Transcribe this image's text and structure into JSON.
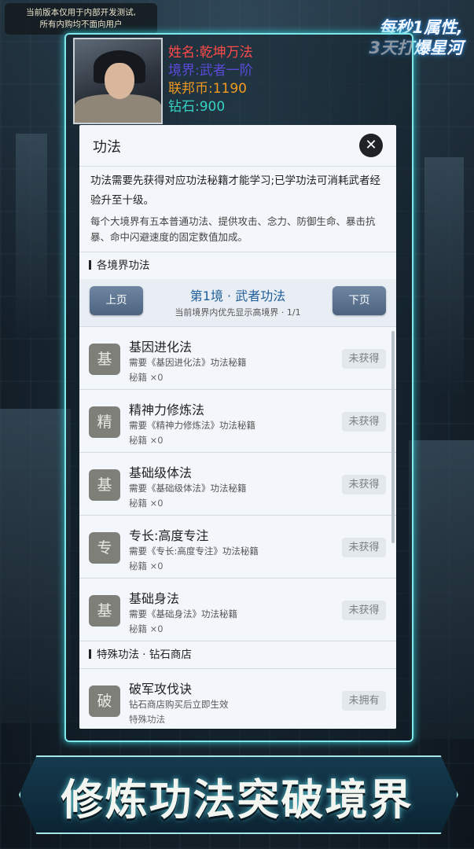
{
  "notice": {
    "line1": "当前版本仅用于内部开发测试,",
    "line2": "所有内购均不面向用户"
  },
  "slogan": {
    "line1": "每秒1属性,",
    "line2": "3天打爆星河"
  },
  "profile": {
    "name": "姓名:乾坤万法",
    "realm": "境界:武者一阶",
    "coin": "联邦币:1190",
    "diamond": "钻石:900"
  },
  "panel": {
    "title": "功法",
    "close_icon": "close-icon",
    "intro_main": "功法需要先获得对应功法秘籍才能学习;已学功法可消耗武者经验升至十级。",
    "intro_sub": "每个大境界有五本普通功法、提供攻击、念力、防御生命、暴击抗暴、命中闪避速度的固定数值加成。",
    "section_realm": "各境界功法",
    "pager": {
      "prev": "上页",
      "next": "下页",
      "title": "第1境 · 武者功法",
      "subtitle": "当前境界内优先显示高境界 · 1/1"
    },
    "items": [
      {
        "icon": "基",
        "name": "基因进化法",
        "req": "需要《基因进化法》功法秘籍",
        "count": "秘籍 ×0",
        "status": "未获得"
      },
      {
        "icon": "精",
        "name": "精神力修炼法",
        "req": "需要《精神力修炼法》功法秘籍",
        "count": "秘籍 ×0",
        "status": "未获得"
      },
      {
        "icon": "基",
        "name": "基础级体法",
        "req": "需要《基础级体法》功法秘籍",
        "count": "秘籍 ×0",
        "status": "未获得"
      },
      {
        "icon": "专",
        "name": "专长:高度专注",
        "req": "需要《专长:高度专注》功法秘籍",
        "count": "秘籍 ×0",
        "status": "未获得"
      },
      {
        "icon": "基",
        "name": "基础身法",
        "req": "需要《基础身法》功法秘籍",
        "count": "秘籍 ×0",
        "status": "未获得"
      }
    ],
    "section_special": "特殊功法 · 钻石商店",
    "special_items": [
      {
        "icon": "破",
        "name": "破军攻伐诀",
        "req": "钻石商店购买后立即生效",
        "count": "特殊功法",
        "status": "未拥有"
      }
    ]
  },
  "banner": {
    "text": "修炼功法突破境界"
  },
  "colors": {
    "accent": "#7fe6e9",
    "name": "#ff4a4a",
    "realm": "#5b4ad8",
    "coin": "#f29a1f",
    "diamond": "#36d3c3"
  }
}
